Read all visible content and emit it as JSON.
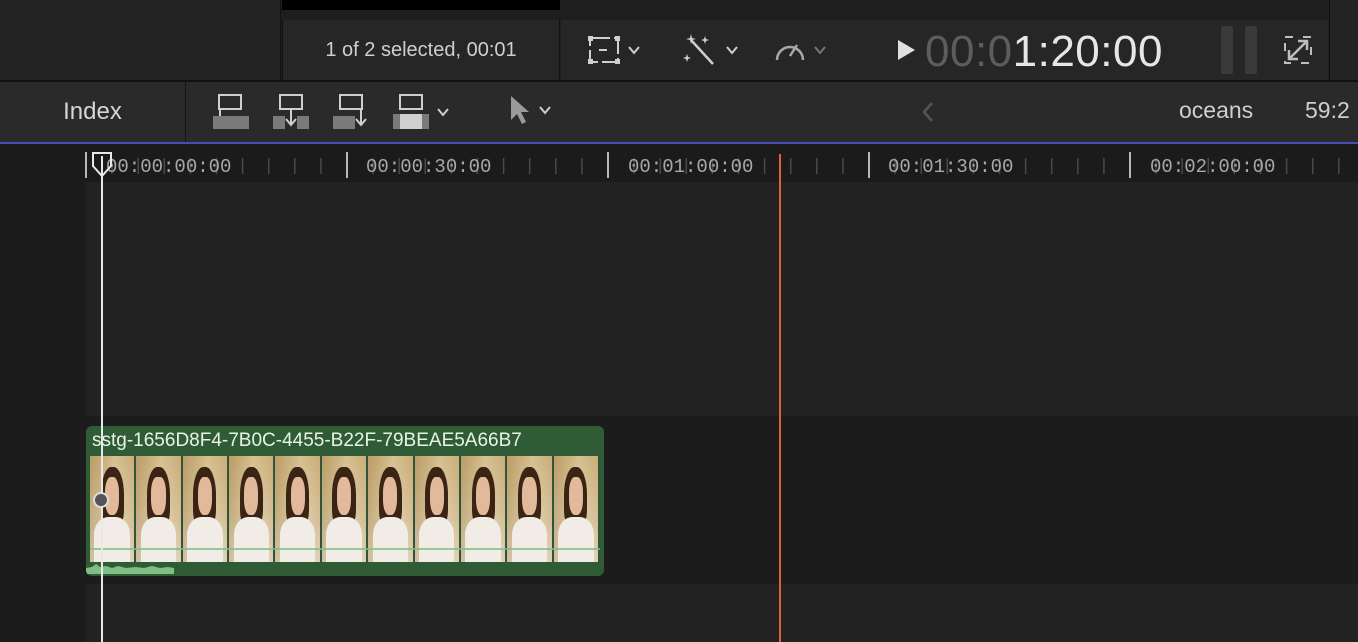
{
  "viewer": {
    "selection_info": "1 of 2 selected, 00:01",
    "timecode_dim": "00:0",
    "timecode_lit": "1:20:00"
  },
  "timeline_toolbar": {
    "index_label": "Index",
    "project_name": "oceans",
    "duration": "59:2"
  },
  "ruler": {
    "labels": [
      "00:00:00:00",
      "00:00:30:00",
      "00:01:00:00",
      "00:01:30:00",
      "00:02:00:00"
    ]
  },
  "clip": {
    "title": "sstg-1656D8F4-7B0C-4455-B22F-79BEAE5A66B7",
    "frame_count": 11
  },
  "colors": {
    "clip_green": "#2f5c35",
    "skimmer": "#e0603b",
    "accent_line": "#4a4bb4"
  },
  "icons": [
    "crop-transform-icon",
    "magic-wand-icon",
    "speed-gauge-icon",
    "play-icon",
    "fullscreen-icon",
    "connect-clip-icon",
    "insert-clip-icon",
    "append-clip-icon",
    "overwrite-clip-icon",
    "select-arrow-icon",
    "back-arrow-icon"
  ]
}
